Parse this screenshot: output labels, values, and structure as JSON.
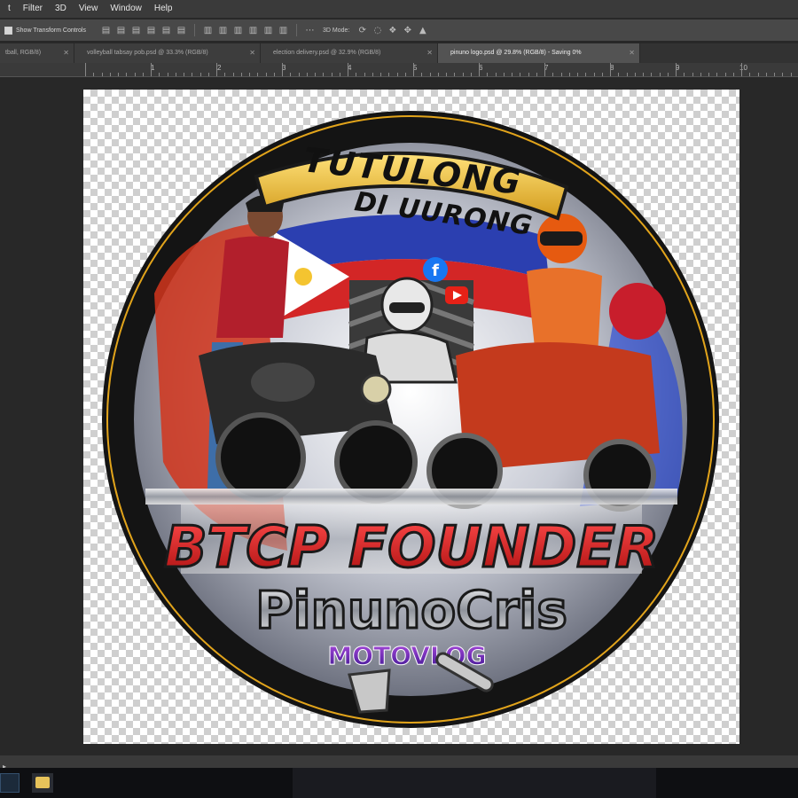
{
  "menu": {
    "items": [
      "t",
      "Filter",
      "3D",
      "View",
      "Window",
      "Help"
    ]
  },
  "options": {
    "checkbox_label": "Show Transform Controls",
    "mode_label": "3D Mode:"
  },
  "tabs": [
    {
      "label": "tball, RGB/8)",
      "active": false
    },
    {
      "label": "volleyball tabsay pob.psd @ 33.3% (RGB/8)",
      "active": false
    },
    {
      "label": "election delivery.psd @ 32.9% (RGB/8)",
      "active": false
    },
    {
      "label": "pinuno logo.psd @ 29.8% (RGB/8) - Saving 0%",
      "active": true
    }
  ],
  "ruler": {
    "numbers": [
      "1",
      "2",
      "3",
      "4",
      "5",
      "6",
      "7",
      "8",
      "9",
      "10"
    ]
  },
  "logo": {
    "top_line1": "TUTULONG",
    "top_line2": "DI UURONG",
    "title": "BTCP FOUNDER",
    "name": "PinunoCris",
    "tagline": "MOTOVLOG",
    "facebook_glyph": "f"
  },
  "colors": {
    "red": "#d21b1b",
    "purple": "#6a1fb0",
    "ring": "#1c1c1c",
    "flag_blue": "#2b3fb0",
    "flag_red": "#d32626"
  }
}
